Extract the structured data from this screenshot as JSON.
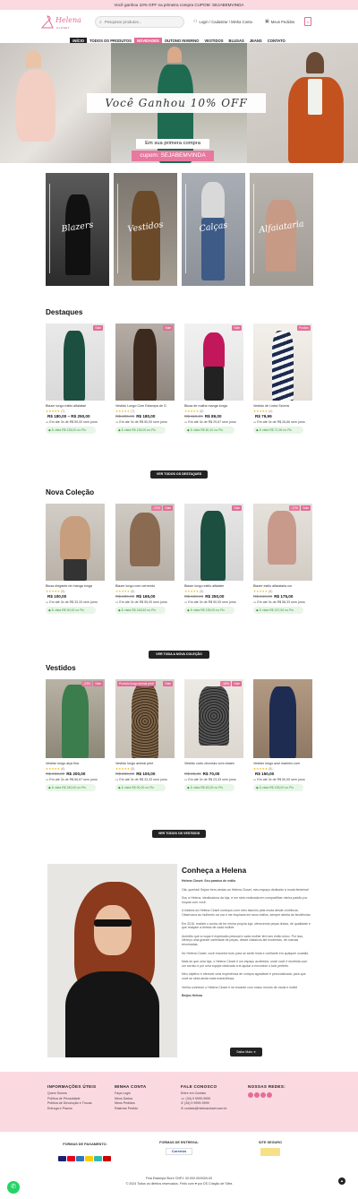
{
  "topbar": {
    "text": "Você ganhou 10% OFF na primeira compra CUPOM: SEJABEMVINDA"
  },
  "header": {
    "logo": "Helena",
    "logo_sub": "CLOSET",
    "search_placeholder": "Pesquisar produtos...",
    "login": "Login / Cadastrar / Minha Conta",
    "orders": "Meus Pedidos",
    "cart_count": "0"
  },
  "nav": [
    "INÍCIO",
    "TODOS OS PRODUTOS",
    "NOVIDADES",
    "OUTONO INVERNO",
    "VESTIDOS",
    "BLUSAS",
    "JEANS",
    "CONTATO"
  ],
  "hero": {
    "banner": "Você Ganhou 10% OFF",
    "line1": "Em sua primera compra",
    "line2": "cupom: SEJABEMVINDA"
  },
  "categories": [
    "Blazers",
    "Vestidos",
    "Calças",
    "Alfaiataria"
  ],
  "destaques": {
    "title": "Destaques",
    "button": "VER TODOS OS DESTAQUES",
    "products": [
      {
        "badge": "Sale",
        "name": "Blazer longo estilo alfaiatari",
        "stars": "★★★★★",
        "count": "(7)",
        "old": "",
        "price": "R$ 180,00 – R$ 250,00",
        "inst": "Em até 3x de R$ 50,00 sem juros",
        "pix": "À vista R$ 135,00 no Pix"
      },
      {
        "badge": "Sale",
        "name": "Vestido Longo Com Estampa de O",
        "stars": "★★★★★",
        "count": "(7)",
        "old": "R$ 209,99",
        "price": "R$ 180,00",
        "inst": "Em até 3x de R$ 50,00 sem juros",
        "pix": "À vista R$ 135,00 no Pix"
      },
      {
        "badge": "Sale",
        "name": "Blusa de malha manga longa",
        "stars": "★★★★★",
        "count": "(6)",
        "old": "R$ 119,99",
        "price": "R$ 89,00",
        "inst": "Em até 3x de R$ 29,67 sem juros",
        "pix": "À vista R$ 80,10 no Pix"
      },
      {
        "badge": "Prodlov",
        "name": "Vestido de Listra Severa",
        "stars": "★★★★★",
        "count": "(4)",
        "old": "",
        "price": "R$ 79,99",
        "inst": "Em até 3x de R$ 26,66 sem juros",
        "pix": "À vista R$ 71,99 no Pix"
      }
    ]
  },
  "nova": {
    "title": "Nova Coleção",
    "button": "VER TODA A NOVA COLEÇÃO",
    "products": [
      {
        "badge": "",
        "name": "Blusa elegante de manga longa",
        "stars": "★★★★★",
        "count": "(5)",
        "old": "",
        "price": "R$ 100,00",
        "inst": "Em até 3x de R$ 33,33 sem juros",
        "pix": "À vista R$ 90,00 no Pix"
      },
      {
        "badge": "Sale",
        "name": "Blazer longo com cerrendo",
        "stars": "★★★★★",
        "count": "(6)",
        "old": "R$ 209,99",
        "price": "R$ 165,00",
        "inst": "Em até 3x de R$ 55,00 sem juros",
        "pix": "À vista R$ 148,50 no Pix"
      },
      {
        "badge": "Sale",
        "name": "Blazer longo estilo alfaiater",
        "stars": "★★★★★",
        "count": "(5)",
        "old": "R$ 180,00",
        "price": "R$ 250,00",
        "inst": "Em até 3x de R$ 50,00 sem juros",
        "pix": "À vista R$ 135,00 no Pix"
      },
      {
        "badge": "Sale",
        "name": "Blazer estilo alfaiataria cur",
        "stars": "★★★★★",
        "count": "(6)",
        "old": "R$ 210,00",
        "price": "R$ 175,00",
        "inst": "Em até 3x de R$ 58,33 sem juros",
        "pix": "À vista R$ 157,50 no Pix"
      }
    ]
  },
  "vestidos": {
    "title": "Vestidos",
    "button": "VER TODOS OS VESTIDOS",
    "products": [
      {
        "badge": "Sale",
        "name": "Vestido longo alça fina",
        "stars": "★★★★★",
        "count": "(6)",
        "old": "R$ 260,00",
        "price": "R$ 200,00",
        "inst": "Em até 3x de R$ 66,67 sem juros",
        "pix": "À vista R$ 180,00 no Pix"
      },
      {
        "badge": "Sale",
        "name": "Vestido longo animal print",
        "stars": "★★★★★",
        "count": "(5)",
        "old": "R$ 209,99",
        "price": "R$ 100,00",
        "inst": "Em até 3x de R$ 33,33 sem juros",
        "pix": "À vista R$ 90,00 no Pix"
      },
      {
        "badge": "Sale",
        "name": "Vestido curto chuvisko com estam",
        "stars": "",
        "count": "",
        "old": "R$ 85,00",
        "price": "R$ 70,00",
        "inst": "Em até 3x de R$ 23,33 sem juros",
        "pix": "À vista R$ 63,00 no Pix"
      },
      {
        "badge": "",
        "name": "Vestido longo azul marinho com",
        "stars": "★★★★★",
        "count": "(5)",
        "old": "",
        "price": "R$ 150,00",
        "inst": "Em até 3x de R$ 50,00 sem juros",
        "pix": "À vista R$ 135,00 no Pix"
      }
    ]
  },
  "about": {
    "title": "Conheça a Helena",
    "lead": "Helena Closet: Seu paraíso de estilo",
    "paras": [
      "Olá, querida! Sejam bem-vindas ao Helena Closet, meu espaço dedicado à moda feminina!",
      "Sou a Helena, idealizadora da loja, e me sinto realizada em compartilhar minha paixão por roupas com você.",
      "A história do Helena Closet começou com meu fascínio pela moda desde a infância. Observava as mulheres na rua e me inspirava em seus estilos, sempre atenta às tendências.",
      "Em 2015, realizei o sonho de ter minha própria loja, oferecendo peças lindas, de qualidade e que realçam a beleza de cada mulher.",
      "Acredito que a roupa é expressão pessoal e cada mulher tem seu estilo único. Por isso, ofereço uma grande variedade de peças, desde clássicos até modernas, de marcas renomadas.",
      "No Helena Closet, você encontra tudo para se sentir linda e confiante em qualquer ocasião.",
      "Mais do que uma loja, o Helena Closet é um espaço acolhedor, onde você é recebida com um sorriso e por uma equipe dedicada a te ajudar a encontrar o look perfeito.",
      "Meu objetivo é oferecer uma experiência de compra agradável e personalizada, para que você se sinta ainda mais maravilhosa.",
      "Venha conhecer o Helena Closet e se encante com nosso mundo de moda e estilo!"
    ],
    "sign": "Beijos Helena",
    "button": "Saiba Mais"
  },
  "footer": {
    "col1": {
      "title": "INFORMAÇÕES ÚTEIS",
      "items": [
        "Quem Somos",
        "Política de Privacidade",
        "Política de Devolução e Trocas",
        "Entrega e Prazos"
      ]
    },
    "col2": {
      "title": "MINHA CONTA",
      "items": [
        "Faça Login",
        "Meus Dados",
        "Meus Pedidos",
        "Rastrear Pedido"
      ]
    },
    "col3": {
      "title": "FALE CONOSCO",
      "items": [
        "Entre em Contato",
        "(34) 9 9999-9999",
        "(34) 9 9999-9999",
        "contato@helenacloset.com.br"
      ]
    },
    "col4": {
      "title": "NOSSAS REDES:"
    }
  },
  "pay": {
    "payment": "FORMAS DE PAGAMENTO:",
    "delivery": "FORMAS DE ENTREGA:",
    "correios": "Correios",
    "safe": "SITE SEGURO"
  },
  "copy": {
    "line1": "Fina Estampa Store CNPJ: 00.000.00/0000-00",
    "line2": "© 2024 Todos os direitos reservados. Feito com ♥ por DS Criação de Sites"
  },
  "colors": {
    "accent": "#e26e97",
    "topbar": "#fbd9e1",
    "pix": "#3a9a3a"
  }
}
